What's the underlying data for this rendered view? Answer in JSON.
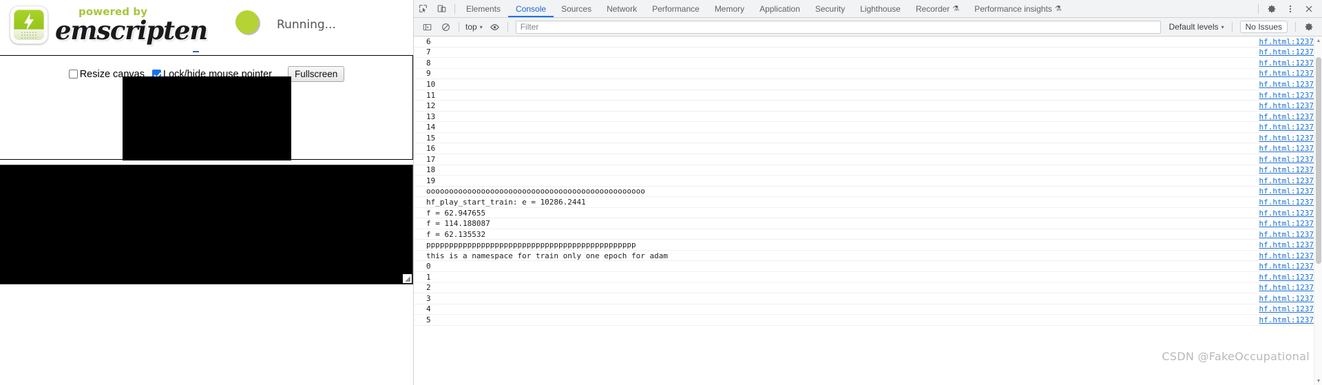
{
  "app": {
    "logo_alt": "emscripten-logo",
    "powered_by": "powered by",
    "name": "emscripten",
    "status": "Running...",
    "controls": {
      "resize_canvas_label": "Resize canvas",
      "resize_canvas_checked": false,
      "lock_pointer_label": "Lock/hide mouse pointer",
      "lock_pointer_checked": true,
      "fullscreen_label": "Fullscreen"
    },
    "canvas_background": "#000000",
    "output_background": "#000000",
    "accent_green": "#b5d334"
  },
  "devtools": {
    "tabs": [
      {
        "label": "Elements",
        "active": false,
        "flask": false
      },
      {
        "label": "Console",
        "active": true,
        "flask": false
      },
      {
        "label": "Sources",
        "active": false,
        "flask": false
      },
      {
        "label": "Network",
        "active": false,
        "flask": false
      },
      {
        "label": "Performance",
        "active": false,
        "flask": false
      },
      {
        "label": "Memory",
        "active": false,
        "flask": false
      },
      {
        "label": "Application",
        "active": false,
        "flask": false
      },
      {
        "label": "Security",
        "active": false,
        "flask": false
      },
      {
        "label": "Lighthouse",
        "active": false,
        "flask": false
      },
      {
        "label": "Recorder",
        "active": false,
        "flask": true
      },
      {
        "label": "Performance insights",
        "active": false,
        "flask": true
      }
    ],
    "flask_glyph": "⚗",
    "toolbar_icons": {
      "inspect": "inspect-element-icon",
      "device": "device-toolbar-icon",
      "settings": "gear-icon",
      "more": "kebab-menu-icon",
      "close": "close-icon"
    },
    "filterbar": {
      "sidebar_icon": "console-sidebar-icon",
      "clear_icon": "clear-console-icon",
      "context": "top",
      "eye_icon": "live-expression-icon",
      "filter_placeholder": "Filter",
      "filter_value": "",
      "levels": "Default levels",
      "issues": "No Issues",
      "settings_icon": "gear-icon",
      "caret": "▾"
    },
    "console_rows": [
      {
        "message": "6",
        "source": "hf.html:1237"
      },
      {
        "message": "7",
        "source": "hf.html:1237"
      },
      {
        "message": "8",
        "source": "hf.html:1237"
      },
      {
        "message": "9",
        "source": "hf.html:1237"
      },
      {
        "message": "10",
        "source": "hf.html:1237"
      },
      {
        "message": "11",
        "source": "hf.html:1237"
      },
      {
        "message": "12",
        "source": "hf.html:1237"
      },
      {
        "message": "13",
        "source": "hf.html:1237"
      },
      {
        "message": "14",
        "source": "hf.html:1237"
      },
      {
        "message": "15",
        "source": "hf.html:1237"
      },
      {
        "message": "16",
        "source": "hf.html:1237"
      },
      {
        "message": "17",
        "source": "hf.html:1237"
      },
      {
        "message": "18",
        "source": "hf.html:1237"
      },
      {
        "message": "19",
        "source": "hf.html:1237"
      },
      {
        "message": "oooooooooooooooooooooooooooooooooooooooooooooooo",
        "source": "hf.html:1237"
      },
      {
        "message": "hf_play_start_train: e = 10286.2441",
        "source": "hf.html:1237"
      },
      {
        "message": "f = 62.947655",
        "source": "hf.html:1237"
      },
      {
        "message": "f = 114.188087",
        "source": "hf.html:1237"
      },
      {
        "message": "f = 62.135532",
        "source": "hf.html:1237"
      },
      {
        "message": "pppppppppppppppppppppppppppppppppppppppppppppp",
        "source": "hf.html:1237"
      },
      {
        "message": "this is a namespace for train only one epoch for adam",
        "source": "hf.html:1237"
      },
      {
        "message": "0",
        "source": "hf.html:1237"
      },
      {
        "message": "1",
        "source": "hf.html:1237"
      },
      {
        "message": "2",
        "source": "hf.html:1237"
      },
      {
        "message": "3",
        "source": "hf.html:1237"
      },
      {
        "message": "4",
        "source": "hf.html:1237"
      },
      {
        "message": "5",
        "source": "hf.html:1237"
      }
    ]
  },
  "watermark": "CSDN @FakeOccupational"
}
